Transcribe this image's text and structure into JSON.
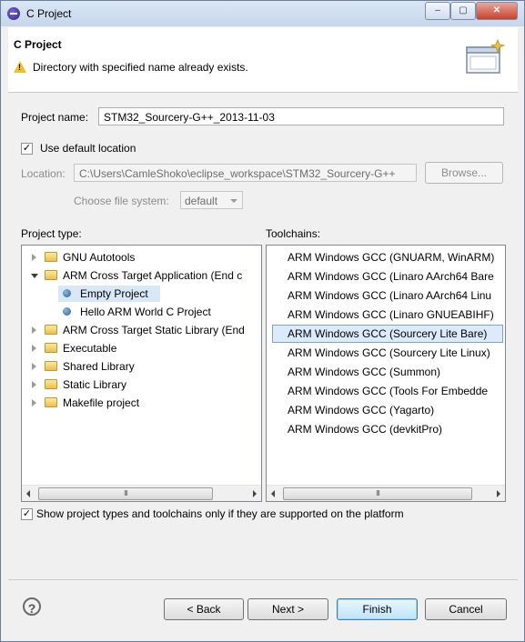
{
  "window": {
    "title": "C Project",
    "controls": {
      "minimize": "–",
      "maximize": "▢",
      "close": "✕"
    }
  },
  "header": {
    "title": "C Project",
    "message": "Directory with specified name already exists.",
    "warning_icon": "warning-icon"
  },
  "project_name": {
    "label": "Project name:",
    "value": "STM32_Sourcery-G++_2013-11-03"
  },
  "default_location": {
    "label": "Use default location",
    "checked": true
  },
  "location": {
    "label": "Location:",
    "value": "C:\\Users\\CamleShoko\\eclipse_workspace\\STM32_Sourcery-G++",
    "browse_label": "Browse..."
  },
  "file_system": {
    "label": "Choose file system:",
    "value": "default"
  },
  "project_type": {
    "label": "Project type:",
    "items": [
      {
        "label": "GNU Autotools",
        "kind": "folder",
        "expanded": false
      },
      {
        "label": "ARM Cross Target Application (End c",
        "kind": "folder",
        "expanded": true
      },
      {
        "label": "Empty Project",
        "kind": "leaf",
        "selected": true
      },
      {
        "label": "Hello ARM World C Project",
        "kind": "leaf"
      },
      {
        "label": "ARM Cross Target Static Library (End",
        "kind": "folder",
        "expanded": false
      },
      {
        "label": "Executable",
        "kind": "folder",
        "expanded": false
      },
      {
        "label": "Shared Library",
        "kind": "folder",
        "expanded": false
      },
      {
        "label": "Static Library",
        "kind": "folder",
        "expanded": false
      },
      {
        "label": "Makefile project",
        "kind": "folder",
        "expanded": false
      }
    ]
  },
  "toolchains": {
    "label": "Toolchains:",
    "items": [
      "ARM Windows GCC (GNUARM, WinARM)",
      "ARM Windows GCC (Linaro AArch64 Bare",
      "ARM Windows GCC (Linaro AArch64 Linu",
      "ARM Windows GCC (Linaro GNUEABIHF)",
      "ARM Windows GCC (Sourcery Lite Bare)",
      "ARM Windows GCC (Sourcery Lite Linux)",
      "ARM Windows GCC (Summon)",
      "ARM Windows GCC (Tools For Embedde",
      "ARM Windows GCC (Yagarto)",
      "ARM Windows GCC (devkitPro)"
    ],
    "selected_index": 4
  },
  "scrollbar_grip": "III",
  "show_supported": {
    "label": "Show project types and toolchains only if they are supported on the platform",
    "checked": true
  },
  "buttons": {
    "help": "?",
    "back": "< Back",
    "next": "Next >",
    "finish": "Finish",
    "cancel": "Cancel"
  }
}
